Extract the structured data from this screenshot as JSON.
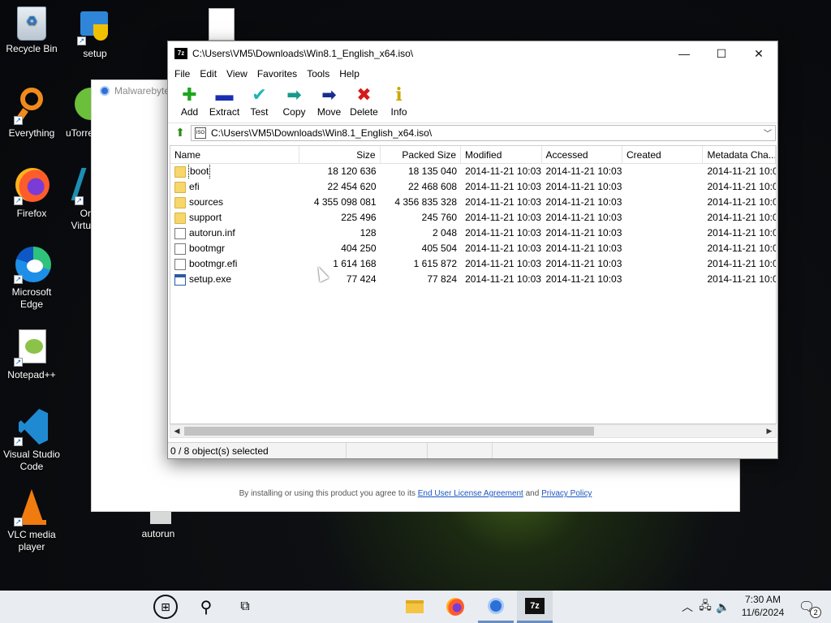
{
  "desktop": {
    "icons": [
      {
        "label": "Recycle Bin"
      },
      {
        "label": "setup"
      },
      {
        "label": "Everything"
      },
      {
        "label": "uTorre"
      },
      {
        "label": "Firefox"
      },
      {
        "label": "Or Virtu"
      },
      {
        "label": "Microsoft Edge"
      },
      {
        "label": "Notepad++"
      },
      {
        "label": "Visual Studio Code"
      },
      {
        "label": "VLC media player"
      },
      {
        "label": "autorun"
      }
    ]
  },
  "malwarebytes": {
    "title": "Malwarebytes",
    "legal_prefix": "By installing or using this product you agree to its",
    "eula_link": "End User License Agreement",
    "and": "and",
    "privacy_link": "Privacy Policy"
  },
  "sevenzip": {
    "app_icon": "7z",
    "title": "C:\\Users\\VM5\\Downloads\\Win8.1_English_x64.iso\\",
    "menu": [
      "File",
      "Edit",
      "View",
      "Favorites",
      "Tools",
      "Help"
    ],
    "toolbar": [
      {
        "label": "Add",
        "icon": "plus-icon",
        "glyph": "✚",
        "color": "#1ea51e"
      },
      {
        "label": "Extract",
        "icon": "minus-icon",
        "glyph": "▬",
        "color": "#1a2fb0"
      },
      {
        "label": "Test",
        "icon": "check-icon",
        "glyph": "✔",
        "color": "#1fb6b6"
      },
      {
        "label": "Copy",
        "icon": "copy-arrow-icon",
        "glyph": "➡",
        "color": "#179a8a"
      },
      {
        "label": "Move",
        "icon": "move-arrow-icon",
        "glyph": "➡",
        "color": "#1b2d8c"
      },
      {
        "label": "Delete",
        "icon": "delete-x-icon",
        "glyph": "✖",
        "color": "#d61a1a"
      },
      {
        "label": "Info",
        "icon": "info-icon",
        "glyph": "i",
        "color": "#c9a800"
      }
    ],
    "address": "C:\\Users\\VM5\\Downloads\\Win8.1_English_x64.iso\\",
    "columns": [
      "Name",
      "Size",
      "Packed Size",
      "Modified",
      "Accessed",
      "Created",
      "Metadata Cha..."
    ],
    "rows": [
      {
        "type": "folder",
        "name": "boot",
        "size": "18 120 636",
        "packed": "18 135 040",
        "modified": "2014-11-21 10:03",
        "accessed": "2014-11-21 10:03",
        "created": "",
        "meta": "2014-11-21 10:0"
      },
      {
        "type": "folder",
        "name": "efi",
        "size": "22 454 620",
        "packed": "22 468 608",
        "modified": "2014-11-21 10:03",
        "accessed": "2014-11-21 10:03",
        "created": "",
        "meta": "2014-11-21 10:0"
      },
      {
        "type": "folder",
        "name": "sources",
        "size": "4 355 098 081",
        "packed": "4 356 835 328",
        "modified": "2014-11-21 10:03",
        "accessed": "2014-11-21 10:03",
        "created": "",
        "meta": "2014-11-21 10:0"
      },
      {
        "type": "folder",
        "name": "support",
        "size": "225 496",
        "packed": "245 760",
        "modified": "2014-11-21 10:03",
        "accessed": "2014-11-21 10:03",
        "created": "",
        "meta": "2014-11-21 10:0"
      },
      {
        "type": "fileinf",
        "name": "autorun.inf",
        "size": "128",
        "packed": "2 048",
        "modified": "2014-11-21 10:03",
        "accessed": "2014-11-21 10:03",
        "created": "",
        "meta": "2014-11-21 10:0"
      },
      {
        "type": "file",
        "name": "bootmgr",
        "size": "404 250",
        "packed": "405 504",
        "modified": "2014-11-21 10:03",
        "accessed": "2014-11-21 10:03",
        "created": "",
        "meta": "2014-11-21 10:0"
      },
      {
        "type": "file",
        "name": "bootmgr.efi",
        "size": "1 614 168",
        "packed": "1 615 872",
        "modified": "2014-11-21 10:03",
        "accessed": "2014-11-21 10:03",
        "created": "",
        "meta": "2014-11-21 10:0"
      },
      {
        "type": "exe",
        "name": "setup.exe",
        "size": "77 424",
        "packed": "77 824",
        "modified": "2014-11-21 10:03",
        "accessed": "2014-11-21 10:03",
        "created": "",
        "meta": "2014-11-21 10:0"
      }
    ],
    "status": "0 / 8 object(s) selected"
  },
  "taskbar": {
    "time": "7:30 AM",
    "date": "11/6/2024",
    "notifications": "2"
  }
}
